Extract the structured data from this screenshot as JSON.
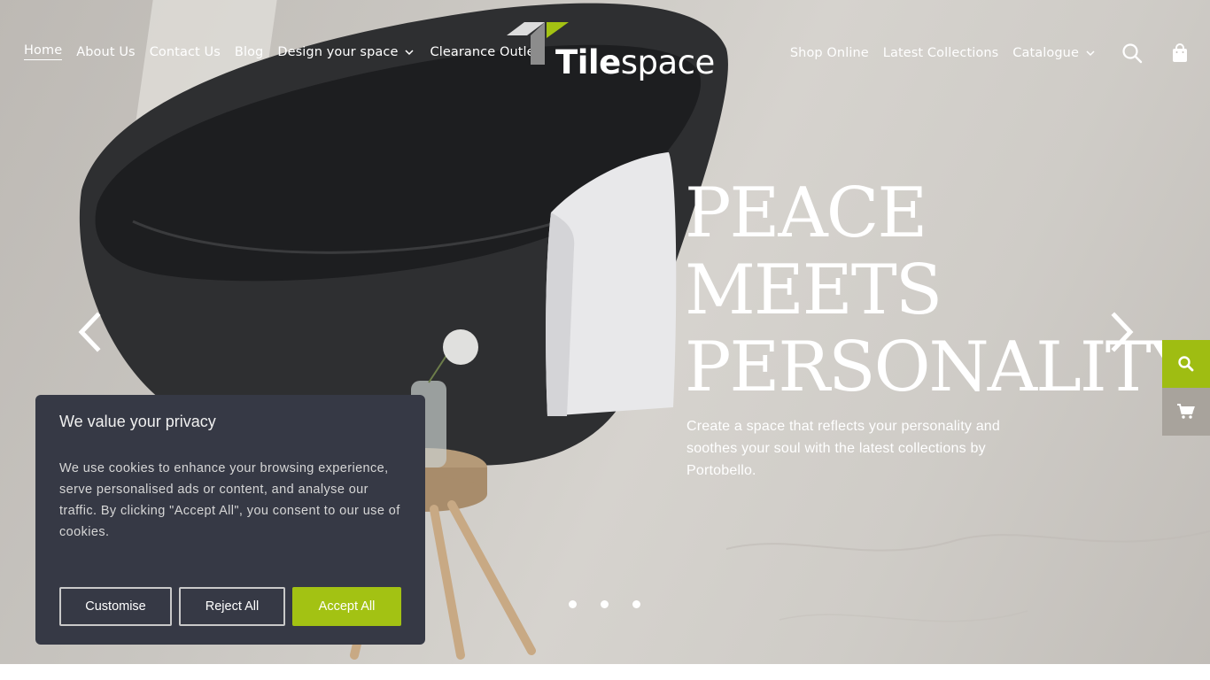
{
  "nav": {
    "left": [
      {
        "label": "Home",
        "active": true
      },
      {
        "label": "About Us"
      },
      {
        "label": "Contact Us"
      },
      {
        "label": "Blog"
      },
      {
        "label": "Design your space",
        "dropdown": true
      },
      {
        "label": "Clearance Outlet"
      }
    ],
    "right": [
      {
        "label": "Shop Online"
      },
      {
        "label": "Latest Collections"
      },
      {
        "label": "Catalogue",
        "dropdown": true
      }
    ],
    "icons": [
      "search-icon",
      "shopping-bag-icon"
    ]
  },
  "logo": {
    "text_bold": "Tile",
    "text_regular": "space",
    "accent_color": "#a3c213"
  },
  "hero": {
    "headline": [
      "PEACE",
      "MEETS",
      "PERSONALITY"
    ],
    "subtext": "Create a space that reflects your personality and soothes your soul with the latest collections by Portobello.",
    "slides_count": 3,
    "active_slide": 1
  },
  "side_tabs": {
    "search_color": "#9fbd12",
    "cart_color": "#a8a39c"
  },
  "cookie": {
    "title": "We value your privacy",
    "body": "We use cookies to enhance your browsing experience, serve personalised ads or content, and analyse our traffic. By clicking \"Accept All\", you consent to our use of cookies.",
    "customise_label": "Customise",
    "reject_label": "Reject All",
    "accept_label": "Accept All",
    "accept_color": "#a3c213",
    "background": "#363945"
  }
}
